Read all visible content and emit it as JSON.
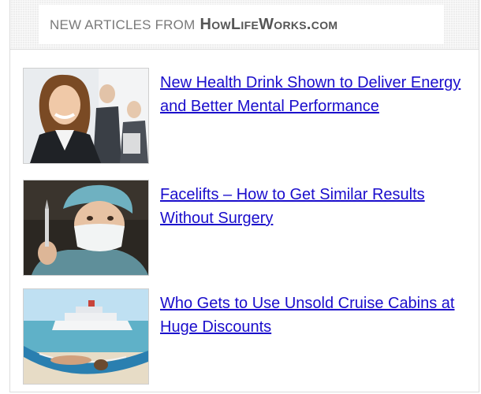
{
  "header": {
    "prefix": "NEW ARTICLES FROM",
    "brand": "HowLifeWorks.com"
  },
  "articles": [
    {
      "title": "New Health Drink Shown to Deliver Energy and Better Mental Performance",
      "image": "business-woman-photo"
    },
    {
      "title": "Facelifts – How to Get Similar Results Without Surgery",
      "image": "surgeon-with-scalpel-photo"
    },
    {
      "title": "Who Gets to Use Unsold Cruise Cabins at Huge Discounts",
      "image": "cruise-ship-hammock-photo"
    }
  ],
  "colors": {
    "link": "#1a0dcc",
    "header_text": "#777777",
    "border": "#dcdcdc"
  }
}
